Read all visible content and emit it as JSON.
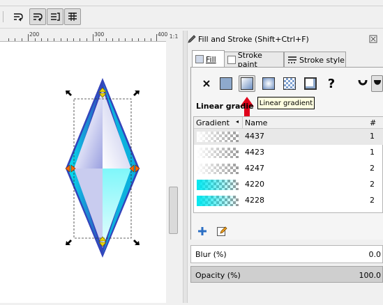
{
  "toolbar": {
    "buttons": [
      {
        "name": "text-flow-button-1",
        "pressed": false
      },
      {
        "name": "text-flow-button-2",
        "pressed": true
      },
      {
        "name": "text-flow-button-3",
        "pressed": true
      },
      {
        "name": "text-flow-button-4",
        "pressed": true
      }
    ]
  },
  "ruler": {
    "labels": [
      "200",
      "300",
      "400"
    ]
  },
  "zoom_corner": "1:1",
  "dialog": {
    "title": "Fill and Stroke (Shift+Ctrl+F)",
    "tabs": [
      {
        "label": "Fill",
        "active": true
      },
      {
        "label": "Stroke paint",
        "active": false
      },
      {
        "label": "Stroke style",
        "active": false
      }
    ],
    "paint_buttons": [
      "no-paint",
      "flat-color",
      "linear-gradient",
      "radial-gradient",
      "pattern",
      "swatch",
      "unset"
    ],
    "tooltip": "Linear gradient",
    "section_heading": "Linear gradie",
    "list": {
      "headers": {
        "gradient": "Gradient",
        "name": "Name",
        "count": "#"
      },
      "rows": [
        {
          "name": "4437",
          "count": "1",
          "swatch": "checker-fade",
          "selected": true
        },
        {
          "name": "4423",
          "count": "1",
          "swatch": "checker-fade",
          "selected": false
        },
        {
          "name": "4247",
          "count": "2",
          "swatch": "checker-fade",
          "selected": false
        },
        {
          "name": "4220",
          "count": "2",
          "swatch": "cyan-fade",
          "selected": false
        },
        {
          "name": "4228",
          "count": "2",
          "swatch": "cyan-fade",
          "selected": false
        }
      ]
    },
    "blur": {
      "label": "Blur (%)",
      "value": "0.0"
    },
    "opacity": {
      "label": "Opacity (%)",
      "value": "100.0"
    }
  },
  "colors": {
    "diamond_stroke": "#3344bb",
    "diamond_cyan": "#00e5f0",
    "handle": "#000000",
    "arrow_red": "#e0001a",
    "tooltip_bg": "#ffffe1"
  }
}
